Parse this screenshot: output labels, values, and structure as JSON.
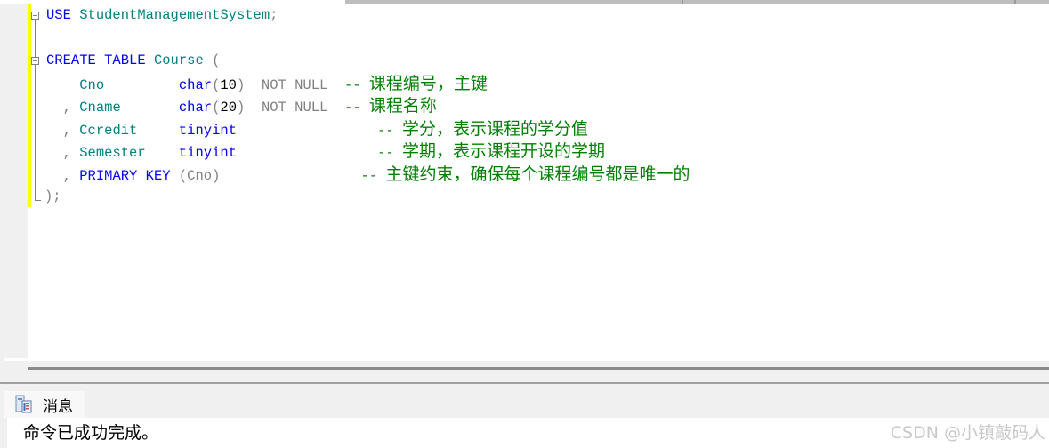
{
  "editor": {
    "lines": [
      {
        "tokens": [
          {
            "t": "USE",
            "c": "kw"
          },
          {
            "t": " ",
            "c": ""
          },
          {
            "t": "StudentManagementSystem",
            "c": "id"
          },
          {
            "t": ";",
            "c": "gr"
          }
        ]
      },
      {
        "tokens": []
      },
      {
        "tokens": [
          {
            "t": "CREATE",
            "c": "kw"
          },
          {
            "t": " ",
            "c": ""
          },
          {
            "t": "TABLE",
            "c": "kw"
          },
          {
            "t": " ",
            "c": ""
          },
          {
            "t": "Course",
            "c": "id"
          },
          {
            "t": " (",
            "c": "gr"
          }
        ]
      },
      {
        "tokens": [
          {
            "t": "    ",
            "c": ""
          },
          {
            "t": "Cno",
            "c": "id"
          },
          {
            "t": "         ",
            "c": ""
          },
          {
            "t": "char",
            "c": "kw"
          },
          {
            "t": "(",
            "c": "gr"
          },
          {
            "t": "10",
            "c": "num"
          },
          {
            "t": ")",
            "c": "gr"
          },
          {
            "t": "  ",
            "c": ""
          },
          {
            "t": "NOT NULL",
            "c": "gr"
          },
          {
            "t": "  ",
            "c": ""
          },
          {
            "t": "-- ",
            "c": "cm"
          }
        ],
        "comment": "课程编号，主键"
      },
      {
        "tokens": [
          {
            "t": "  ",
            "c": ""
          },
          {
            "t": ",",
            "c": "gr"
          },
          {
            "t": " ",
            "c": ""
          },
          {
            "t": "Cname",
            "c": "id"
          },
          {
            "t": "       ",
            "c": ""
          },
          {
            "t": "char",
            "c": "kw"
          },
          {
            "t": "(",
            "c": "gr"
          },
          {
            "t": "20",
            "c": "num"
          },
          {
            "t": ")",
            "c": "gr"
          },
          {
            "t": "  ",
            "c": ""
          },
          {
            "t": "NOT NULL",
            "c": "gr"
          },
          {
            "t": "  ",
            "c": ""
          },
          {
            "t": "-- ",
            "c": "cm"
          }
        ],
        "comment": "课程名称"
      },
      {
        "tokens": [
          {
            "t": "  ",
            "c": ""
          },
          {
            "t": ",",
            "c": "gr"
          },
          {
            "t": " ",
            "c": ""
          },
          {
            "t": "Ccredit",
            "c": "id"
          },
          {
            "t": "     ",
            "c": ""
          },
          {
            "t": "tinyint",
            "c": "kw"
          },
          {
            "t": "                ",
            "c": ""
          },
          {
            "t": " -- ",
            "c": "cm"
          }
        ],
        "comment": "学分，表示课程的学分值"
      },
      {
        "tokens": [
          {
            "t": "  ",
            "c": ""
          },
          {
            "t": ",",
            "c": "gr"
          },
          {
            "t": " ",
            "c": ""
          },
          {
            "t": "Semester",
            "c": "id"
          },
          {
            "t": "    ",
            "c": ""
          },
          {
            "t": "tinyint",
            "c": "kw"
          },
          {
            "t": "                ",
            "c": ""
          },
          {
            "t": " -- ",
            "c": "cm"
          }
        ],
        "comment": "学期，表示课程开设的学期"
      },
      {
        "tokens": [
          {
            "t": "  ",
            "c": ""
          },
          {
            "t": ",",
            "c": "gr"
          },
          {
            "t": " ",
            "c": ""
          },
          {
            "t": "PRIMARY KEY",
            "c": "kw"
          },
          {
            "t": " ",
            "c": ""
          },
          {
            "t": "(Cno)",
            "c": "gr"
          },
          {
            "t": "                ",
            "c": ""
          },
          {
            "t": " -- ",
            "c": "cm"
          }
        ],
        "comment": "主键约束，确保每个课程编号都是唯一的"
      },
      {
        "tokens": [
          {
            "t": ");",
            "c": "gr"
          }
        ]
      }
    ]
  },
  "results": {
    "tab_label": "消息",
    "message": "命令已成功完成。"
  },
  "watermark": "CSDN @小镇敲码人",
  "colors": {
    "keyword": "#0000ff",
    "identifier": "#008080",
    "operator": "#808080",
    "comment": "#008000",
    "change_bar": "#ffff00"
  }
}
